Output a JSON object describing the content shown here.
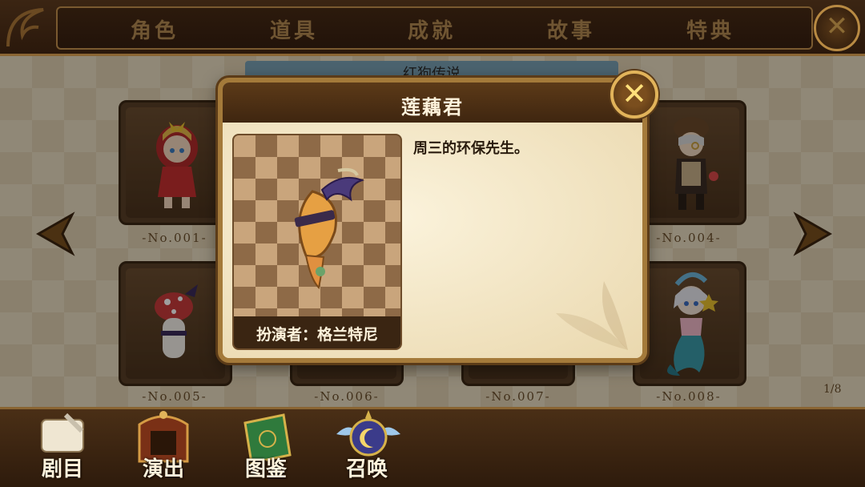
{
  "top_tabs": [
    "角色",
    "道具",
    "成就",
    "故事",
    "特典"
  ],
  "strip_title": "红狗传说",
  "cards": [
    {
      "number": "-No.001-"
    },
    {
      "number": "-No.004-"
    },
    {
      "number": "-No.005-"
    },
    {
      "number": "-No.006-"
    },
    {
      "number": "-No.007-"
    },
    {
      "number": "-No.008-"
    }
  ],
  "page_indicator": "1/8",
  "bottom_nav": [
    "剧目",
    "演出",
    "图鉴",
    "召唤"
  ],
  "modal": {
    "title": "莲藕君",
    "description": "周三的环保先生。",
    "actor": "扮演者：格兰特尼",
    "close_icon": "close-icon"
  },
  "colors": {
    "accent_gold": "#e1b35a",
    "dark_brown": "#3a2412",
    "parchment": "#f3e6c6"
  }
}
